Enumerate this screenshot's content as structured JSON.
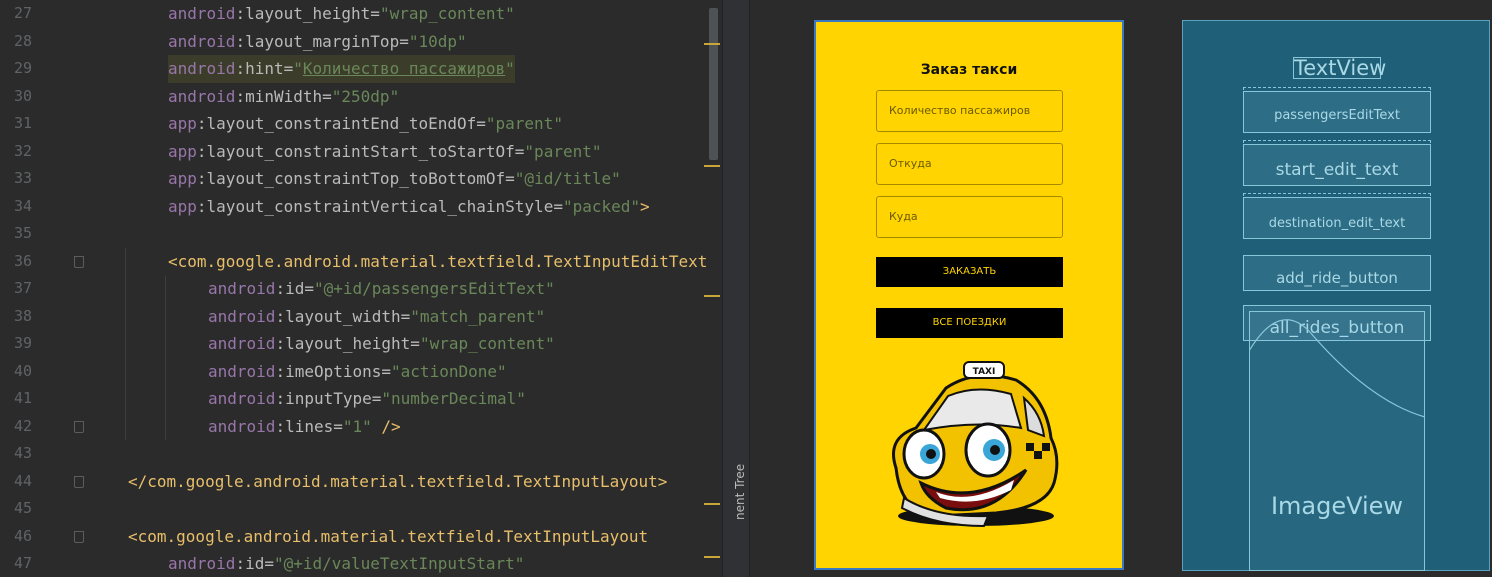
{
  "editor": {
    "lines": [
      {
        "num": "27",
        "indent": 2,
        "tokens": [
          {
            "t": "android",
            "c": "ns"
          },
          {
            "t": ":layout_height=",
            "c": "attr"
          },
          {
            "t": "\"wrap_content\"",
            "c": "str"
          }
        ]
      },
      {
        "num": "28",
        "indent": 2,
        "tokens": [
          {
            "t": "android",
            "c": "ns"
          },
          {
            "t": ":layout_marginTop=",
            "c": "attr"
          },
          {
            "t": "\"10dp\"",
            "c": "str"
          }
        ]
      },
      {
        "num": "29",
        "indent": 2,
        "highlight": true,
        "tokens": [
          {
            "t": "android",
            "c": "ns"
          },
          {
            "t": ":hint=",
            "c": "attr"
          },
          {
            "t": "\"",
            "c": "str"
          },
          {
            "t": "Количество пассажиров",
            "c": "str u"
          },
          {
            "t": "\"",
            "c": "str"
          }
        ]
      },
      {
        "num": "30",
        "indent": 2,
        "tokens": [
          {
            "t": "android",
            "c": "ns"
          },
          {
            "t": ":minWidth=",
            "c": "attr"
          },
          {
            "t": "\"250dp\"",
            "c": "str"
          }
        ]
      },
      {
        "num": "31",
        "indent": 2,
        "tokens": [
          {
            "t": "app",
            "c": "ns"
          },
          {
            "t": ":layout_constraintEnd_toEndOf=",
            "c": "attr"
          },
          {
            "t": "\"parent\"",
            "c": "str"
          }
        ]
      },
      {
        "num": "32",
        "indent": 2,
        "tokens": [
          {
            "t": "app",
            "c": "ns"
          },
          {
            "t": ":layout_constraintStart_toStartOf=",
            "c": "attr"
          },
          {
            "t": "\"parent\"",
            "c": "str"
          }
        ]
      },
      {
        "num": "33",
        "indent": 2,
        "tokens": [
          {
            "t": "app",
            "c": "ns"
          },
          {
            "t": ":layout_constraintTop_toBottomOf=",
            "c": "attr"
          },
          {
            "t": "\"@id/title\"",
            "c": "str"
          }
        ]
      },
      {
        "num": "34",
        "indent": 2,
        "tokens": [
          {
            "t": "app",
            "c": "ns"
          },
          {
            "t": ":layout_constraintVertical_chainStyle=",
            "c": "attr"
          },
          {
            "t": "\"packed\"",
            "c": "str"
          },
          {
            "t": ">",
            "c": "punct"
          }
        ]
      },
      {
        "num": "35",
        "indent": 0,
        "tokens": []
      },
      {
        "num": "36",
        "indent": 2,
        "fold": true,
        "tokens": [
          {
            "t": "<com.google.android.material.textfield.TextInputEditText",
            "c": "tag"
          }
        ]
      },
      {
        "num": "37",
        "indent": 3,
        "tokens": [
          {
            "t": "android",
            "c": "ns"
          },
          {
            "t": ":id=",
            "c": "attr"
          },
          {
            "t": "\"@+id/passengersEditText\"",
            "c": "str"
          }
        ]
      },
      {
        "num": "38",
        "indent": 3,
        "tokens": [
          {
            "t": "android",
            "c": "ns"
          },
          {
            "t": ":layout_width=",
            "c": "attr"
          },
          {
            "t": "\"match_parent\"",
            "c": "str"
          }
        ]
      },
      {
        "num": "39",
        "indent": 3,
        "tokens": [
          {
            "t": "android",
            "c": "ns"
          },
          {
            "t": ":layout_height=",
            "c": "attr"
          },
          {
            "t": "\"wrap_content\"",
            "c": "str"
          }
        ]
      },
      {
        "num": "40",
        "indent": 3,
        "tokens": [
          {
            "t": "android",
            "c": "ns"
          },
          {
            "t": ":imeOptions=",
            "c": "attr"
          },
          {
            "t": "\"actionDone\"",
            "c": "str"
          }
        ]
      },
      {
        "num": "41",
        "indent": 3,
        "tokens": [
          {
            "t": "android",
            "c": "ns"
          },
          {
            "t": ":inputType=",
            "c": "attr"
          },
          {
            "t": "\"numberDecimal\"",
            "c": "str"
          }
        ]
      },
      {
        "num": "42",
        "indent": 3,
        "fold": true,
        "tokens": [
          {
            "t": "android",
            "c": "ns"
          },
          {
            "t": ":lines=",
            "c": "attr"
          },
          {
            "t": "\"1\"",
            "c": "str"
          },
          {
            "t": " />",
            "c": "punct"
          }
        ]
      },
      {
        "num": "43",
        "indent": 0,
        "tokens": []
      },
      {
        "num": "44",
        "indent": 1,
        "fold": true,
        "tokens": [
          {
            "t": "</com.google.android.material.textfield.TextInputLayout>",
            "c": "tag"
          }
        ]
      },
      {
        "num": "45",
        "indent": 0,
        "tokens": []
      },
      {
        "num": "46",
        "indent": 1,
        "fold": true,
        "tokens": [
          {
            "t": "<com.google.android.material.textfield.TextInputLayout",
            "c": "tag"
          }
        ]
      },
      {
        "num": "47",
        "indent": 2,
        "tokens": [
          {
            "t": "android",
            "c": "ns"
          },
          {
            "t": ":id=",
            "c": "attr"
          },
          {
            "t": "\"@+id/valueTextInputStart\"",
            "c": "str"
          }
        ]
      }
    ]
  },
  "side_panel": {
    "label": "nent Tree"
  },
  "preview": {
    "title": "Заказ такси",
    "passengers_hint": "Количество пассажиров",
    "from_hint": "Откуда",
    "to_hint": "Куда",
    "order_button": "ЗАКАЗАТЬ",
    "all_rides_button": "ВСЕ ПОЕЗДКИ",
    "taxi_sign": "TAXI"
  },
  "blueprint": {
    "title_view": "TextView",
    "passengers": "passengersEditText",
    "start": "start_edit_text",
    "destination": "destination_edit_text",
    "add_ride": "add_ride_button",
    "all_rides": "all_rides_button",
    "image_view": "ImageView"
  },
  "colors": {
    "preview_bg": "#ffd400",
    "blueprint_bg": "#1f5f78",
    "button_bg": "#000000",
    "button_text": "#ffd400"
  }
}
